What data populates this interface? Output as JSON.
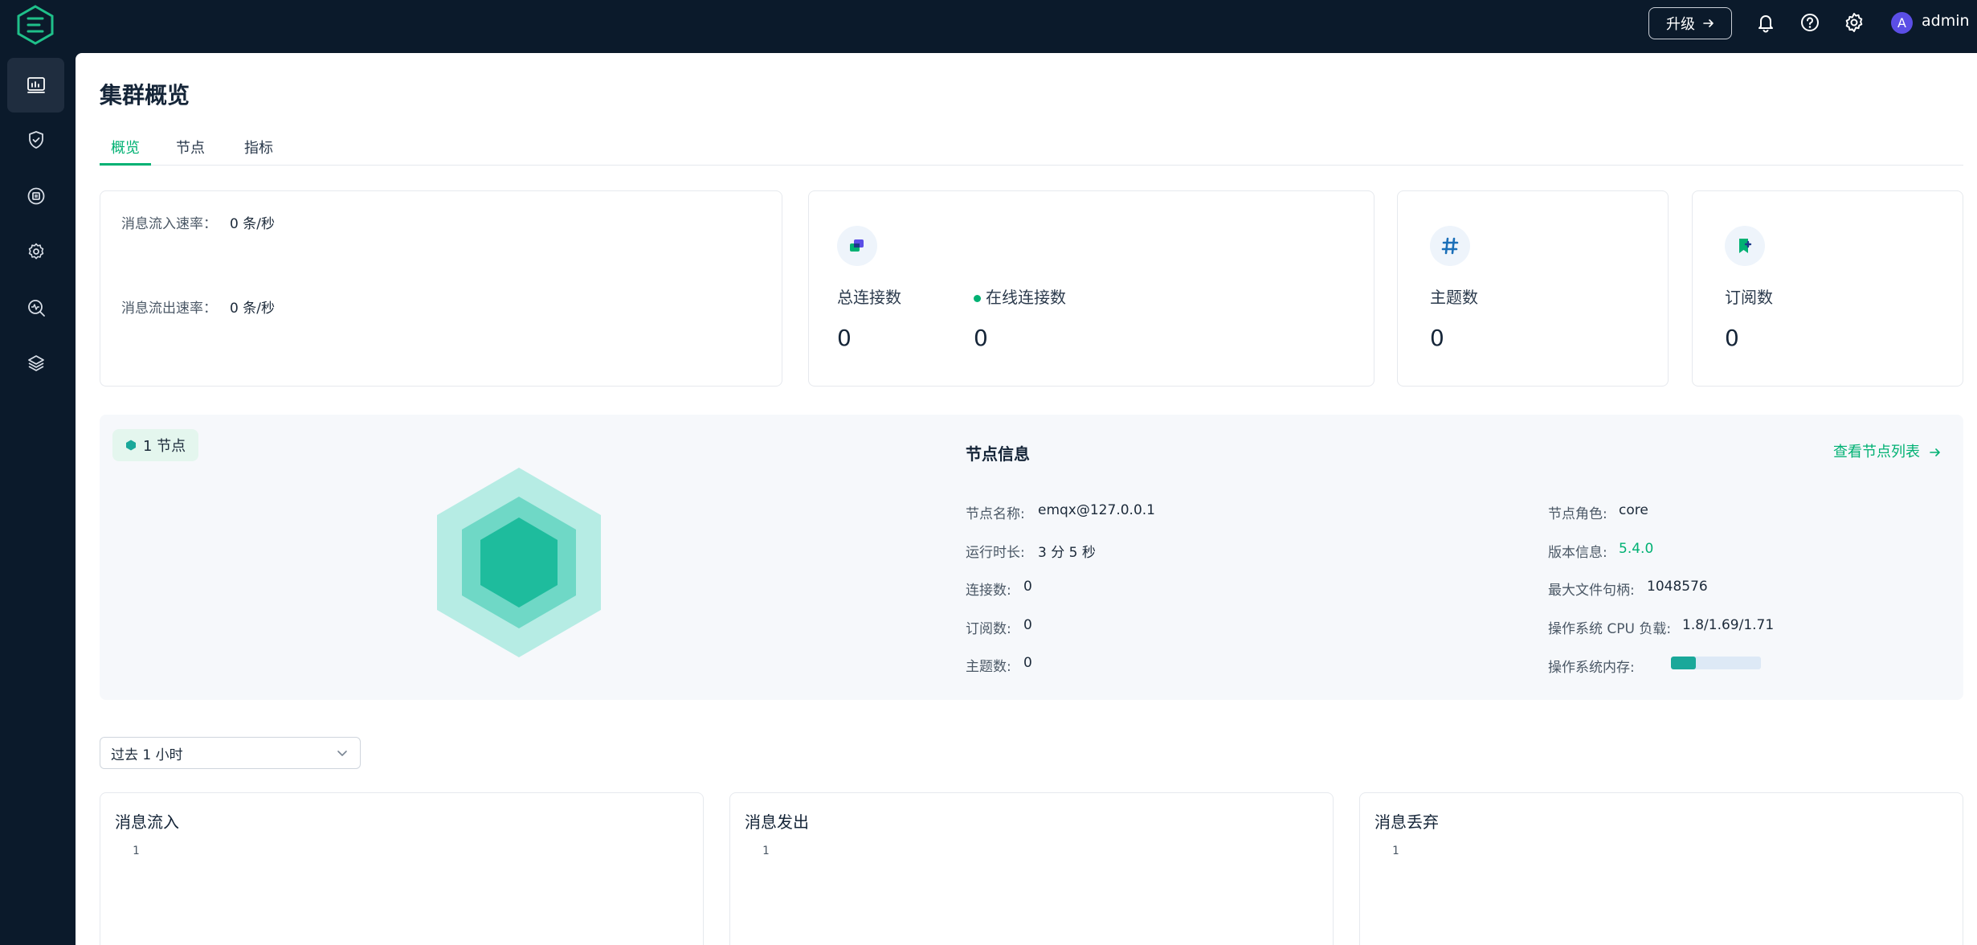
{
  "app": {
    "upgrade_label": "升级",
    "username": "admin",
    "avatar_letter": "A",
    "accent_color": "#00b173"
  },
  "sidebar": {
    "items": [
      {
        "icon": "dashboard-icon",
        "active": true
      },
      {
        "icon": "shield-check-icon",
        "active": false
      },
      {
        "icon": "chip-icon",
        "active": false
      },
      {
        "icon": "gear-management-icon",
        "active": false
      },
      {
        "icon": "diagnose-icon",
        "active": false
      },
      {
        "icon": "layers-icon",
        "active": false
      }
    ]
  },
  "page": {
    "title": "集群概览",
    "tabs": [
      {
        "label": "概览",
        "active": true
      },
      {
        "label": "节点",
        "active": false
      },
      {
        "label": "指标",
        "active": false
      }
    ]
  },
  "rates": {
    "in_label": "消息流入速率：",
    "in_value": "0 条/秒",
    "out_label": "消息流出速率：",
    "out_value": "0 条/秒"
  },
  "stats": {
    "total_connections_label": "总连接数",
    "total_connections_value": "0",
    "online_connections_label": "在线连接数",
    "online_connections_value": "0",
    "topics_label": "主题数",
    "topics_value": "0",
    "subscriptions_label": "订阅数",
    "subscriptions_value": "0"
  },
  "node": {
    "badge": "1 节点",
    "info_title": "节点信息",
    "list_link": "查看节点列表",
    "left": [
      {
        "label": "节点名称:",
        "value": "emqx@127.0.0.1"
      },
      {
        "label": "运行时长:",
        "value": "3 分 5 秒"
      },
      {
        "label": "连接数:",
        "value": "0"
      },
      {
        "label": "订阅数:",
        "value": "0"
      },
      {
        "label": "主题数:",
        "value": "0"
      }
    ],
    "right": [
      {
        "label": "节点角色:",
        "value": "core"
      },
      {
        "label": "版本信息:",
        "value": "5.4.0"
      },
      {
        "label": "最大文件句柄:",
        "value": "1048576"
      },
      {
        "label": "操作系统 CPU 负载:",
        "value": "1.8/1.69/1.71"
      },
      {
        "label": "操作系统内存:",
        "value": ""
      }
    ],
    "memory_usage_fraction": 0.28
  },
  "time_range": {
    "selected": "过去 1 小时"
  },
  "charts": [
    {
      "title": "消息流入",
      "tick": "1"
    },
    {
      "title": "消息发出",
      "tick": "1"
    },
    {
      "title": "消息丢弃",
      "tick": "1"
    }
  ]
}
